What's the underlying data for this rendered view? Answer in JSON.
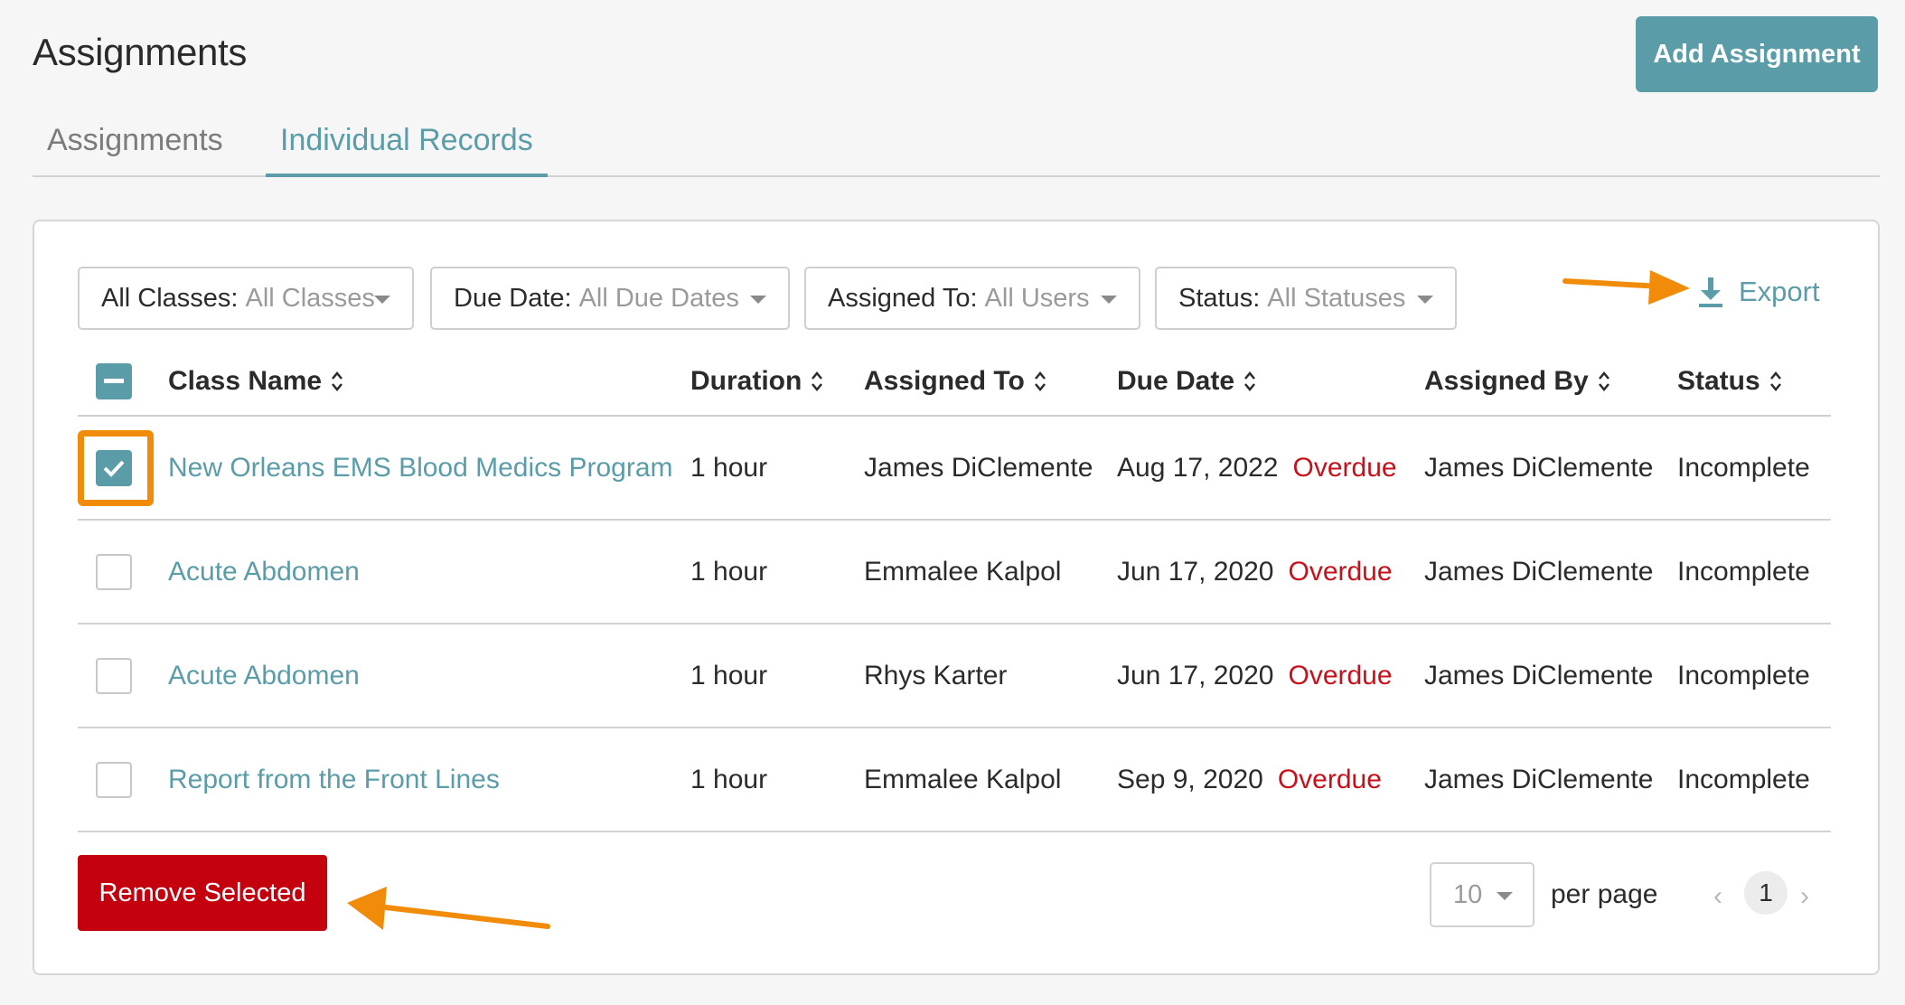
{
  "page": {
    "title": "Assignments",
    "add_button": "Add Assignment"
  },
  "tabs": [
    {
      "label": "Assignments",
      "active": false
    },
    {
      "label": "Individual Records",
      "active": true
    }
  ],
  "filters": [
    {
      "label": "All Classes:",
      "value": "All Classes"
    },
    {
      "label": "Due Date:",
      "value": "All Due Dates"
    },
    {
      "label": "Assigned To:",
      "value": "All Users"
    },
    {
      "label": "Status:",
      "value": "All Statuses"
    }
  ],
  "export_label": "Export",
  "table": {
    "columns": [
      "Class Name",
      "Duration",
      "Assigned To",
      "Due Date",
      "Assigned By",
      "Status"
    ],
    "rows": [
      {
        "checked": true,
        "class_name": "New Orleans EMS Blood Medics Program",
        "duration": "1 hour",
        "assigned_to": "James DiClemente",
        "due_date": "Aug 17, 2022",
        "overdue": "Overdue",
        "assigned_by": "James DiClemente",
        "status": "Incomplete"
      },
      {
        "checked": false,
        "class_name": "Acute Abdomen",
        "duration": "1 hour",
        "assigned_to": "Emmalee Kalpol",
        "due_date": "Jun 17, 2020",
        "overdue": "Overdue",
        "assigned_by": "James DiClemente",
        "status": "Incomplete"
      },
      {
        "checked": false,
        "class_name": "Acute Abdomen",
        "duration": "1 hour",
        "assigned_to": "Rhys Karter",
        "due_date": "Jun 17, 2020",
        "overdue": "Overdue",
        "assigned_by": "James DiClemente",
        "status": "Incomplete"
      },
      {
        "checked": false,
        "class_name": "Report from the Front Lines",
        "duration": "1 hour",
        "assigned_to": "Emmalee Kalpol",
        "due_date": "Sep 9, 2020",
        "overdue": "Overdue",
        "assigned_by": "James DiClemente",
        "status": "Incomplete"
      }
    ]
  },
  "footer": {
    "remove_button": "Remove Selected",
    "per_page_value": "10",
    "per_page_label": "per page",
    "current_page": "1"
  },
  "colors": {
    "accent": "#5a9da8",
    "danger": "#c4000e",
    "overdue": "#c8101a",
    "annotation": "#f08c0a"
  },
  "icons": [
    "sort-icon",
    "download-icon",
    "chevron-left-icon",
    "chevron-right-icon",
    "checkmark-icon"
  ]
}
